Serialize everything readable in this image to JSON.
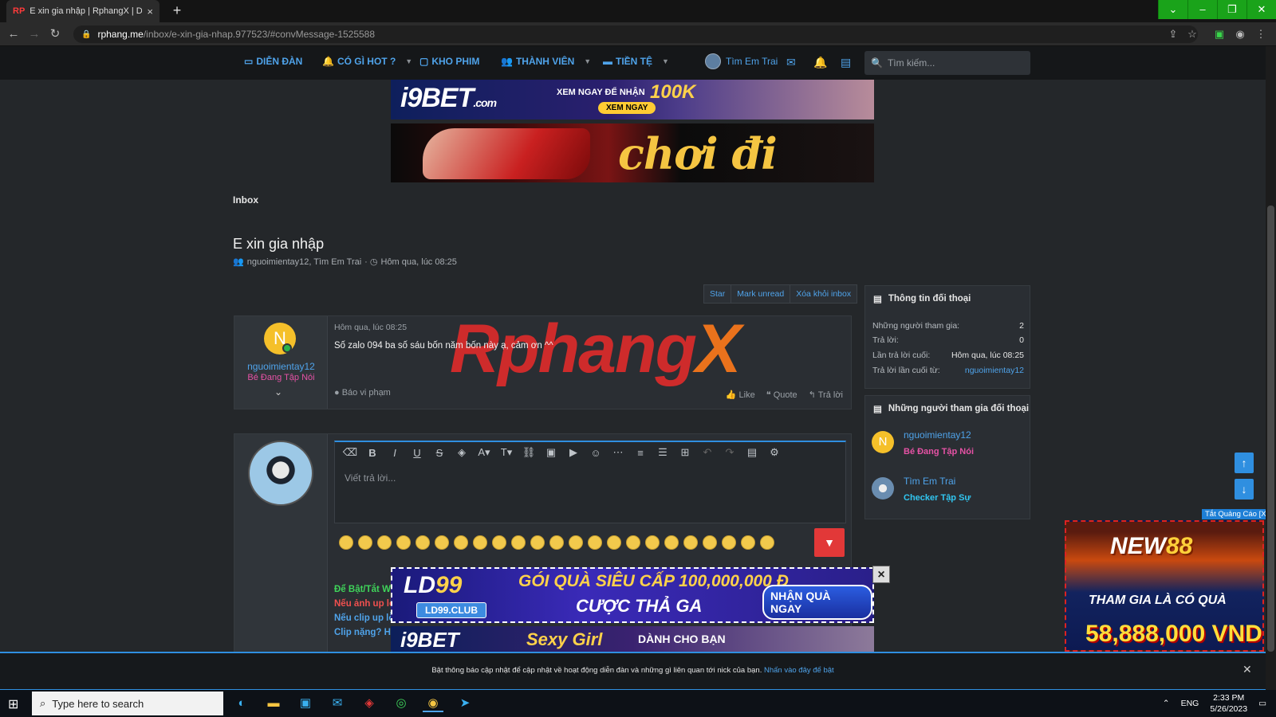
{
  "browser": {
    "tab_favicon": "RP",
    "tab_title": "E xin gia nhập | RphangX | Diễn Đ",
    "url_host": "rphang.me",
    "url_path": "/inbox/e-xin-gia-nhap.977523/#convMessage-1525588"
  },
  "nav": {
    "items": [
      {
        "label": "DIỄN ĐÀN",
        "icon": "chat-icon"
      },
      {
        "label": "CÓ GÌ HOT ?",
        "icon": "bell-icon"
      },
      {
        "label": "KHO PHIM",
        "icon": "video-icon"
      },
      {
        "label": "THÀNH VIÊN",
        "icon": "users-icon"
      },
      {
        "label": "TIỀN TỆ",
        "icon": "folder-icon"
      }
    ],
    "username": "Tìm Em Trai",
    "search_placeholder": "Tìm kiếm..."
  },
  "banners": {
    "i9bet": {
      "logo": "i9BET",
      "domain": ".com",
      "line1": "XEM NGAY ĐỂ NHẬN",
      "amount": "100K",
      "cta": "XEM NGAY"
    },
    "choidianh": {
      "text": "chơi đi anh"
    }
  },
  "page": {
    "breadcrumb": "Inbox",
    "title": "E xin gia nhập",
    "participants_meta": "nguoimientay12, Tìm Em Trai",
    "date_meta": "Hôm qua, lúc 08:25",
    "actions": [
      "Star",
      "Mark unread",
      "Xóa khỏi inbox"
    ]
  },
  "message": {
    "avatar_letter": "N",
    "username": "nguoimientay12",
    "user_title": "Bé Đang Tập Nói",
    "time": "Hôm qua, lúc 08:25",
    "body": "Số zalo 094 ba số sáu bốn năm bốn này ạ, cảm ơn ^^",
    "watermark": {
      "a": "Rphang",
      "b": "X"
    },
    "report": "Báo vi phạm",
    "like": "Like",
    "quote": "Quote",
    "reply": "Trả lời"
  },
  "reply": {
    "placeholder": "Viết trả lời...",
    "hints": [
      "Để Bật/Tắt Wa",
      "Nếu ảnh up lỗ",
      "Nếu clip up lỗ",
      "Clip nặng? Hã"
    ]
  },
  "sidebar": {
    "info_title": "Thông tin đối thoại",
    "info": [
      {
        "k": "Những người tham gia:",
        "v": "2"
      },
      {
        "k": "Trả lời:",
        "v": "0"
      },
      {
        "k": "Lần trả lời cuối:",
        "v": "Hôm qua, lúc 08:25"
      },
      {
        "k": "Trả lời lần cuối từ:",
        "v": "nguoimientay12"
      }
    ],
    "participants_title": "Những người tham gia đối thoại",
    "participants": [
      {
        "avatar_letter": "N",
        "name": "nguoimientay12",
        "title": "Bé Đang Tập Nói",
        "title_color": "#e552a5"
      },
      {
        "name": "Tìm Em Trai",
        "title": "Checker Tập Sự",
        "title_color": "#31c6f0"
      }
    ]
  },
  "ads": {
    "tag": "Tắt Quảng Cáo [X]",
    "new88": {
      "logo_a": "NEW",
      "logo_b": "88",
      "line1": "THAM GIA LÀ CÓ QUÀ",
      "amount": "58,888,000 VND"
    },
    "ld99": {
      "logo_a": "LD",
      "logo_b": "99",
      "club": "LD99.CLUB",
      "line1": "GÓI QUÀ SIÊU CẤP 100,000,000 Đ",
      "line2": "CƯỢC THẢ GA",
      "cta": "NHẬN QUÀ NGAY"
    },
    "sexy": {
      "logo": "i9BET",
      "line1": "Sexy Girl",
      "line2": "DÀNH CHO BẠN"
    },
    "close": "×"
  },
  "notification": {
    "text": "Bật thông báo cập nhật để cập nhật về hoạt động diễn đàn và những gì liên quan tới nick của bạn. ",
    "link": "Nhấn vào đây để bật"
  },
  "taskbar": {
    "search_placeholder": "Type here to search",
    "lang": "ENG",
    "time": "2:33 PM",
    "date": "5/26/2023"
  },
  "colors": {
    "accent": "#2f8fe0",
    "link": "#4fa3ea",
    "bg": "#24272a"
  }
}
